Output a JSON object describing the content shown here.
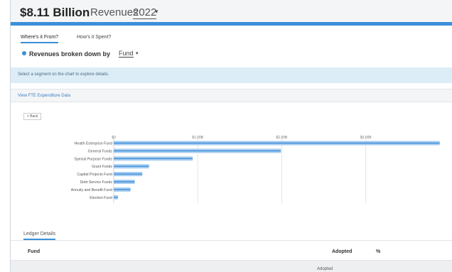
{
  "header": {
    "amount": "$8.11 Billion",
    "label": "Revenues",
    "year": "2022",
    "accent": "#3b8fd9"
  },
  "tabs": [
    {
      "label": "Where's it From?",
      "active": true
    },
    {
      "label": "How's it Spent?",
      "active": false
    }
  ],
  "breakdown": {
    "prefix": "Revenues broken down by",
    "selected": "Fund"
  },
  "info_message": "Select a segment on the chart to explore details.",
  "fte_link": "View FTE Expenditure Data",
  "back_button": "< Back",
  "chart_data": {
    "type": "bar",
    "orientation": "horizontal",
    "categories": [
      "Health Enterprise Fund",
      "General Funds",
      "Special Purpose Funds",
      "Grant Funds",
      "Capital Projects Fund",
      "Debt Service Funds",
      "Annuity and Benefit Fund",
      "Election Fund"
    ],
    "values": [
      3.88,
      1.99,
      0.94,
      0.42,
      0.34,
      0.25,
      0.2,
      0.05
    ],
    "xticks": [
      "$0",
      "$1.00B",
      "$2.00B",
      "$3.00B"
    ],
    "xlim": [
      0,
      3.95
    ],
    "grid": true,
    "bar_color": "#a9cdf0",
    "bar_edge_color": "#3b8fd9"
  },
  "ledger": {
    "tab": "Ledger Details",
    "columns": [
      "Fund",
      "Adopted",
      "%"
    ],
    "subheader": "Adopted"
  }
}
